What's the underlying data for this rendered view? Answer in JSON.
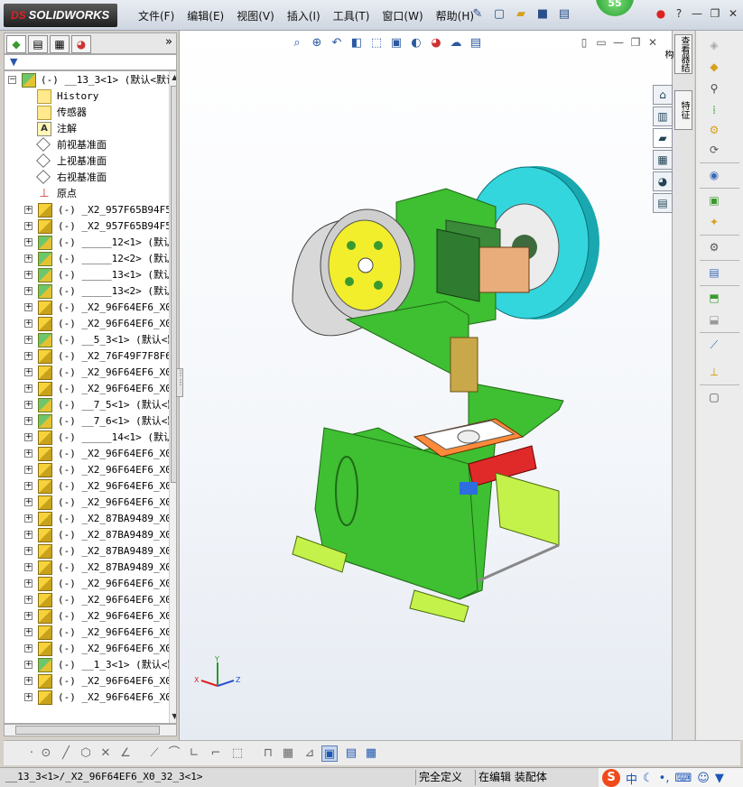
{
  "app": {
    "logo_ds": "DS",
    "logo_text": "SOLIDWORKS",
    "notification_count": "55",
    "menu": [
      "文件(F)",
      "编辑(E)",
      "视图(V)",
      "插入(I)",
      "工具(T)",
      "窗口(W)",
      "帮助(H)"
    ],
    "quick_access_icons": [
      "pin-icon",
      "new-document-icon",
      "open-folder-icon",
      "save-icon",
      "print-icon",
      "traffic-light-icon",
      "help-icon"
    ]
  },
  "feature_tree": {
    "tabs": [
      "feature-manager-icon",
      "property-manager-icon",
      "configuration-manager-icon",
      "appearance-icon"
    ],
    "expand_glyph": "»",
    "filter_glyph": "▼",
    "root": "(-) __13_3<1> (默认<默认",
    "items": [
      {
        "label": "History",
        "icon": "history-icon",
        "expandable": false
      },
      {
        "label": "传感器",
        "icon": "sensor-icon",
        "expandable": false
      },
      {
        "label": "注解",
        "icon": "annotation-icon",
        "expandable": false
      },
      {
        "label": "前视基准面",
        "icon": "plane-icon",
        "expandable": false
      },
      {
        "label": "上视基准面",
        "icon": "plane-icon",
        "expandable": false
      },
      {
        "label": "右视基准面",
        "icon": "plane-icon",
        "expandable": false
      },
      {
        "label": "原点",
        "icon": "origin-icon",
        "expandable": false
      },
      {
        "label": "(-) _X2_957F65B94F53",
        "icon": "part-icon",
        "expandable": true
      },
      {
        "label": "(-) _X2_957F65B94F53",
        "icon": "part-icon",
        "expandable": true
      },
      {
        "label": "(-) _____12<1> (默认",
        "icon": "subassembly-icon",
        "expandable": true
      },
      {
        "label": "(-) _____12<2> (默认",
        "icon": "subassembly-icon",
        "expandable": true
      },
      {
        "label": "(-) _____13<1> (默认",
        "icon": "subassembly-icon",
        "expandable": true
      },
      {
        "label": "(-) _____13<2> (默认",
        "icon": "subassembly-icon",
        "expandable": true
      },
      {
        "label": "(-) _X2_96F64EF6_X0_",
        "icon": "part-icon",
        "expandable": true
      },
      {
        "label": "(-) _X2_96F64EF6_X0_",
        "icon": "part-icon",
        "expandable": true
      },
      {
        "label": "(-) __5_3<1> (默认<默",
        "icon": "subassembly-icon",
        "expandable": true
      },
      {
        "label": "(-) _X2_76F49F7F8F6E",
        "icon": "part-icon",
        "expandable": true
      },
      {
        "label": "(-) _X2_96F64EF6_X0_",
        "icon": "part-icon",
        "expandable": true
      },
      {
        "label": "(-) _X2_96F64EF6_X0_",
        "icon": "part-icon",
        "expandable": true
      },
      {
        "label": "(-) __7_5<1> (默认<默",
        "icon": "subassembly-icon",
        "expandable": true
      },
      {
        "label": "(-) __7_6<1> (默认<默",
        "icon": "subassembly-icon",
        "expandable": true
      },
      {
        "label": "(-) _____14<1> (默认",
        "icon": "part-icon",
        "expandable": true
      },
      {
        "label": "(-) _X2_96F64EF6_X0_",
        "icon": "part-icon",
        "expandable": true
      },
      {
        "label": "(-) _X2_96F64EF6_X0_",
        "icon": "part-icon",
        "expandable": true
      },
      {
        "label": "(-) _X2_96F64EF6_X0_",
        "icon": "part-icon",
        "expandable": true
      },
      {
        "label": "(-) _X2_96F64EF6_X0_",
        "icon": "part-icon",
        "expandable": true
      },
      {
        "label": "(-) _X2_87BA9489_X0_",
        "icon": "part-icon",
        "expandable": true
      },
      {
        "label": "(-) _X2_87BA9489_X0_",
        "icon": "part-icon",
        "expandable": true
      },
      {
        "label": "(-) _X2_87BA9489_X0_",
        "icon": "part-icon",
        "expandable": true
      },
      {
        "label": "(-) _X2_87BA9489_X0_",
        "icon": "part-icon",
        "expandable": true
      },
      {
        "label": "(-) _X2_96F64EF6_X0_",
        "icon": "part-icon",
        "expandable": true
      },
      {
        "label": "(-) _X2_96F64EF6_X0_",
        "icon": "part-icon",
        "expandable": true
      },
      {
        "label": "(-) _X2_96F64EF6_X0_",
        "icon": "part-icon",
        "expandable": true
      },
      {
        "label": "(-) _X2_96F64EF6_X0_",
        "icon": "part-icon",
        "expandable": true
      },
      {
        "label": "(-) _X2_96F64EF6_X0_",
        "icon": "part-icon",
        "expandable": true
      },
      {
        "label": "(-) __1_3<1> (默认<默",
        "icon": "subassembly-icon",
        "expandable": true
      },
      {
        "label": "(-) _X2_96F64EF6_X0_",
        "icon": "part-icon",
        "expandable": true
      },
      {
        "label": "(-) _X2_96F64EF6_X0_",
        "icon": "part-icon",
        "expandable": true
      }
    ]
  },
  "viewport": {
    "heads_up_icons": [
      "zoom-to-fit-icon",
      "zoom-area-icon",
      "previous-view-icon",
      "section-view-icon",
      "view-orientation-icon",
      "display-style-icon",
      "hide-show-icon",
      "edit-appearance-icon",
      "apply-scene-icon",
      "view-settings-icon"
    ],
    "triad": {
      "x": "X",
      "y": "Y",
      "z": "Z"
    },
    "colors": {
      "frame": "#3fbf32",
      "flywheel": "#33d6dc",
      "pulley_face": "#f2ee2c",
      "head": "#3a8a3a",
      "bed": "#ff8a3a",
      "clamp": "#e02a2a",
      "foot": "#c4f24a"
    }
  },
  "task_pane": {
    "vertical_tabs": [
      "查看器结构",
      "特征"
    ],
    "buttons": [
      "home-icon",
      "design-library-icon",
      "file-explorer-icon",
      "view-palette-icon",
      "appearances-icon",
      "custom-properties-icon"
    ]
  },
  "command_bar": {
    "icons": [
      "insert-component-icon",
      "mate-icon",
      "paperclip-icon",
      "linear-pattern-icon",
      "smart-fastener-icon",
      "move-component-icon",
      "show-hidden-icon",
      "assembly-features-icon",
      "reference-geometry-icon",
      "new-motion-icon",
      "bill-of-materials-icon",
      "exploded-view-icon",
      "explode-line-icon",
      "interference-icon",
      "clearance-icon",
      "measure-icon",
      "mass-properties-icon",
      "properties-icon"
    ]
  },
  "sketch_toolbar": {
    "icons": [
      "point-icon",
      "circle-icon",
      "line-icon",
      "polygon-icon",
      "trim-icon",
      "extend-icon",
      "centerline-icon",
      "fillet-icon",
      "chamfer-icon",
      "offset-icon",
      "mirror-icon",
      "dimension-icon",
      "grid-icon",
      "angle-icon",
      "box-view-icon",
      "tile-horizontal-icon",
      "tile-vertical-icon"
    ]
  },
  "status_bar": {
    "path": "__13_3<1>/_X2_96F64EF6_X0_32_3<1>",
    "definition": "完全定义",
    "mode": "在编辑 装配体",
    "ime_mode": "中"
  }
}
